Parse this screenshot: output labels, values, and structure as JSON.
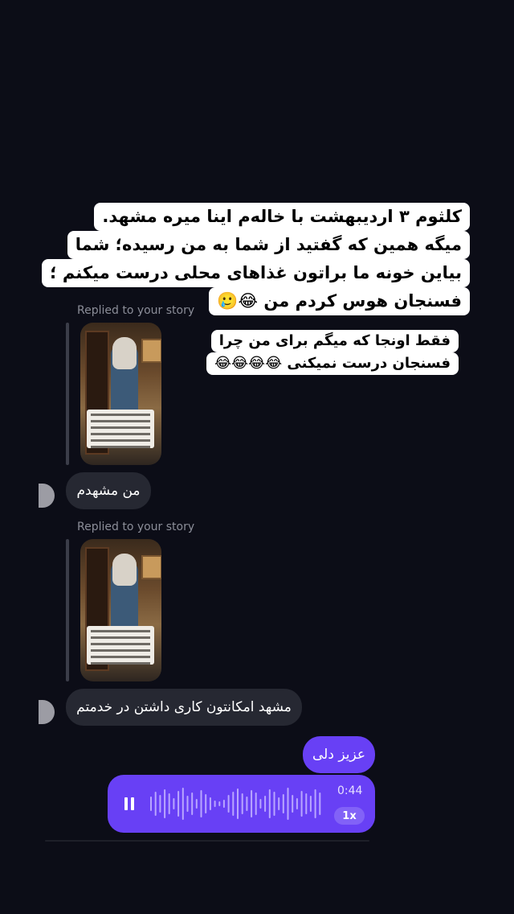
{
  "story_caption_top": {
    "lines": [
      "کلثوم ۳ اردیبهشت با خاله‌م اینا میره مشهد.",
      "میگه همین که گفتید از شما به من رسیده؛ شما",
      "بیاین خونه ما براتون غذاهای محلی درست میکنم ؛",
      "فسنجان هوس کردم من 😂🥲"
    ]
  },
  "story_caption_mid": {
    "lines": [
      "فقط اونجا که میگم برای من چرا",
      "فسنجان درست نمیکنی 😂😂😂😂"
    ]
  },
  "messages": {
    "reply1_label": "Replied to your story",
    "incoming1": "من مشهدم",
    "reply2_label": "Replied to your story",
    "incoming2": "مشهد امکانتون کاری داشتن در خدمتم",
    "outgoing1": "عزیز دلی"
  },
  "voice_message": {
    "duration": "0:44",
    "speed": "1x",
    "state": "playing",
    "progress": 0,
    "icon": "pause-icon"
  },
  "colors": {
    "background": "#0c0d17",
    "incoming_bubble": "#262832",
    "outgoing_bubble": "#6840f5",
    "caption_box": "#ffffff"
  }
}
